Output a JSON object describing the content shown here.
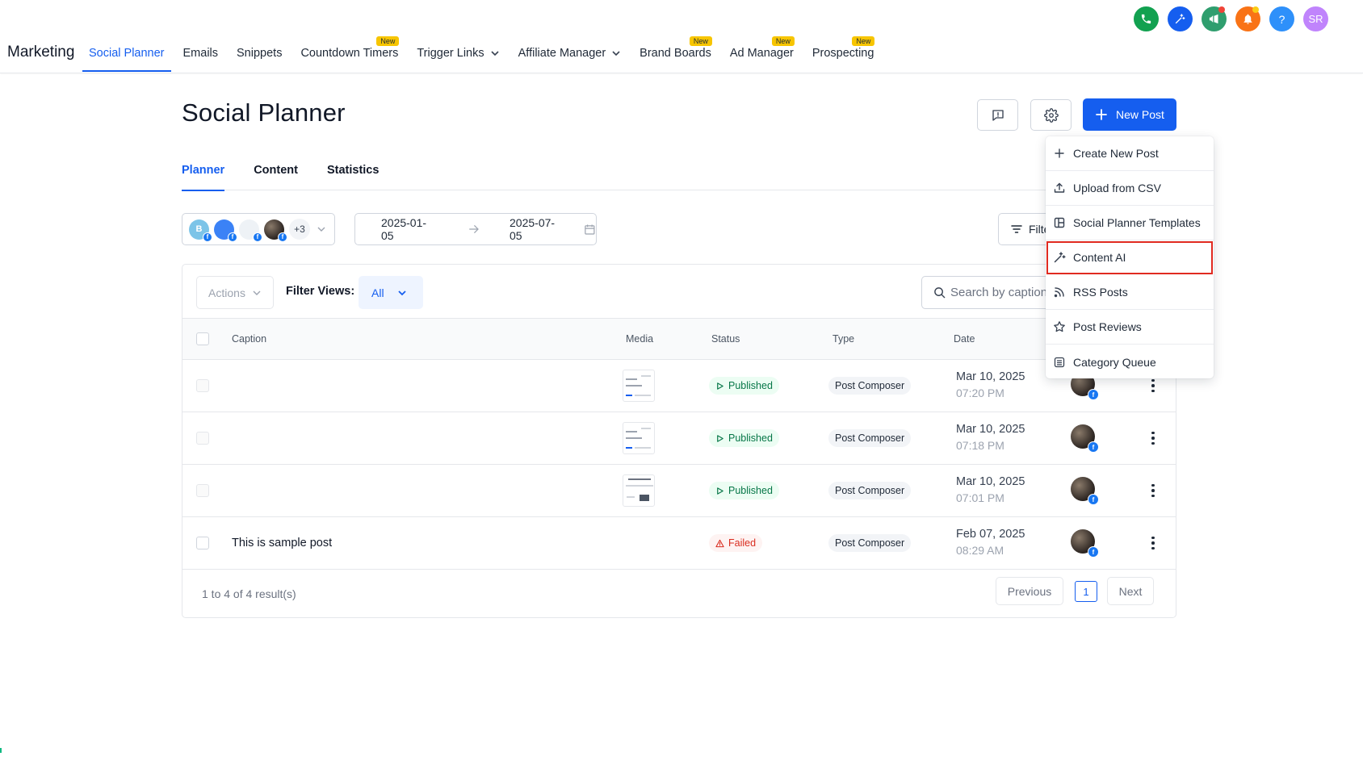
{
  "top_icons": [
    {
      "name": "phone-icon",
      "color": "#12a150"
    },
    {
      "name": "sparkle-icon",
      "color": "#155eef"
    },
    {
      "name": "megaphone-icon",
      "color": "#2f9e6e",
      "dot_color": "#f04438"
    },
    {
      "name": "bell-icon",
      "color": "#f97316",
      "dot_color": "#facc15"
    },
    {
      "name": "help-icon",
      "color": "#2e90fa"
    },
    {
      "name": "avatar",
      "color": "#c084fc"
    }
  ],
  "user_initials": "SR",
  "help_glyph": "?",
  "nav": {
    "brand": "Marketing",
    "new_badge": "New",
    "items": [
      {
        "label": "Social Planner"
      },
      {
        "label": "Emails"
      },
      {
        "label": "Snippets"
      },
      {
        "label": "Countdown Timers"
      },
      {
        "label": "Trigger Links"
      },
      {
        "label": "Affiliate Manager"
      },
      {
        "label": "Brand Boards"
      },
      {
        "label": "Ad Manager"
      },
      {
        "label": "Prospecting"
      }
    ]
  },
  "page": {
    "title": "Social Planner",
    "new_post_label": "New Post"
  },
  "tabs": [
    "Planner",
    "Content",
    "Statistics"
  ],
  "filters": {
    "account_initial": "B",
    "account_more": "+3",
    "date_start": "2025-01-05",
    "date_end": "2025-07-05",
    "filter_label": "Filters",
    "fb_glyph": "f"
  },
  "table_toolbar": {
    "actions_label": "Actions",
    "filter_views_label": "Filter Views:",
    "filter_views_value": "All",
    "search_placeholder": "Search by caption"
  },
  "table": {
    "headers": {
      "caption": "Caption",
      "media": "Media",
      "status": "Status",
      "type": "Type",
      "date": "Date"
    },
    "rows": [
      {
        "caption": "",
        "status": "Published",
        "type": "Post Composer",
        "date": "Mar 10, 2025",
        "time": "07:20 PM"
      },
      {
        "caption": "",
        "status": "Published",
        "type": "Post Composer",
        "date": "Mar 10, 2025",
        "time": "07:18 PM"
      },
      {
        "caption": "",
        "status": "Published",
        "type": "Post Composer",
        "date": "Mar 10, 2025",
        "time": "07:01 PM"
      },
      {
        "caption": "This is sample post",
        "status": "Failed",
        "type": "Post Composer",
        "date": "Feb 07, 2025",
        "time": "08:29 AM"
      }
    ]
  },
  "pagination": {
    "results_text": "1 to 4 of 4 result(s)",
    "previous": "Previous",
    "current_page": "1",
    "next": "Next"
  },
  "new_post_menu": [
    {
      "label": "Create New Post",
      "icon": "plus-icon"
    },
    {
      "label": "Upload from CSV",
      "icon": "upload-icon"
    },
    {
      "label": "Social Planner Templates",
      "icon": "template-icon"
    },
    {
      "label": "Content AI",
      "icon": "sparkle-icon",
      "highlighted": true
    },
    {
      "label": "RSS Posts",
      "icon": "rss-icon"
    },
    {
      "label": "Post Reviews",
      "icon": "star-icon"
    },
    {
      "label": "Category Queue",
      "icon": "queue-icon"
    }
  ],
  "colors": {
    "primary": "#155eef",
    "published": "#067647",
    "failed": "#d92d20",
    "highlight_border": "#e02a20"
  }
}
